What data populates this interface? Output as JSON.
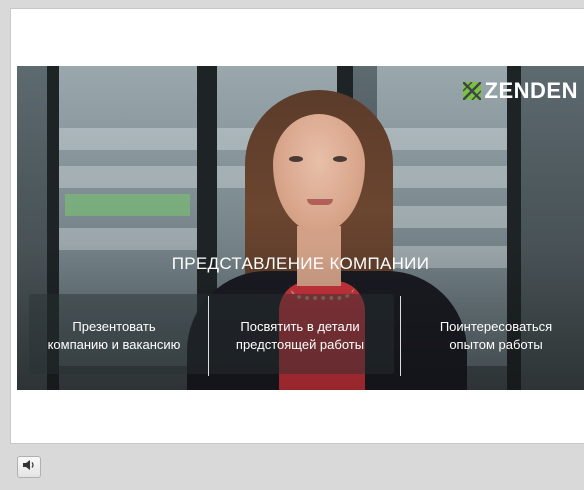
{
  "video": {
    "logo_text": "ZENDEN",
    "headline": "ПРЕДСТАВЛЕНИЕ КОМПАНИИ",
    "options": [
      {
        "line1": "Презентовать",
        "line2": "компанию и вакансию"
      },
      {
        "line1": "Посвятить в детали",
        "line2": "предстоящей работы"
      },
      {
        "line1": "Поинтересоваться",
        "line2": "опытом работы"
      }
    ]
  },
  "controls": {
    "volume_icon": "speaker-icon"
  },
  "colors": {
    "logo_green": "#7cc242",
    "frame_bg": "#d9d9d9",
    "stage_bg": "#ffffff"
  }
}
